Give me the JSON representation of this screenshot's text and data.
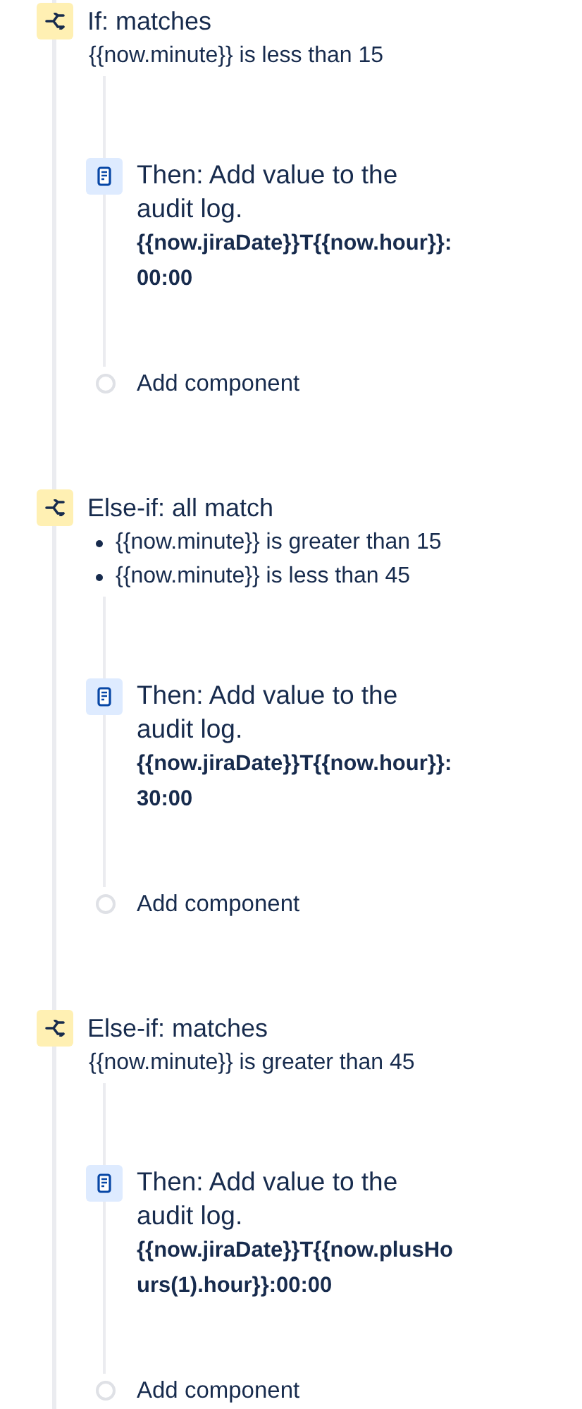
{
  "blocks": [
    {
      "title": "If: matches",
      "kind": "plain",
      "conditions": [
        "{{now.minute}} is less than 15"
      ],
      "action": {
        "label": "Then: Add value to the audit log.",
        "value": "{{now.jiraDate}}T{{now.hour}}:00:00"
      },
      "add_label": "Add component"
    },
    {
      "title": "Else-if: all match",
      "kind": "bulleted",
      "conditions": [
        "{{now.minute}} is greater than 15",
        "{{now.minute}} is less than 45"
      ],
      "action": {
        "label": "Then: Add value to the audit log.",
        "value": "{{now.jiraDate}}T{{now.hour}}:30:00"
      },
      "add_label": "Add component"
    },
    {
      "title": "Else-if: matches",
      "kind": "plain",
      "conditions": [
        "{{now.minute}} is greater than 45"
      ],
      "action": {
        "label": "Then: Add value to the audit log.",
        "value": "{{now.jiraDate}}T{{now.plusHours(1).hour}}:00:00"
      },
      "add_label": "Add component"
    }
  ]
}
